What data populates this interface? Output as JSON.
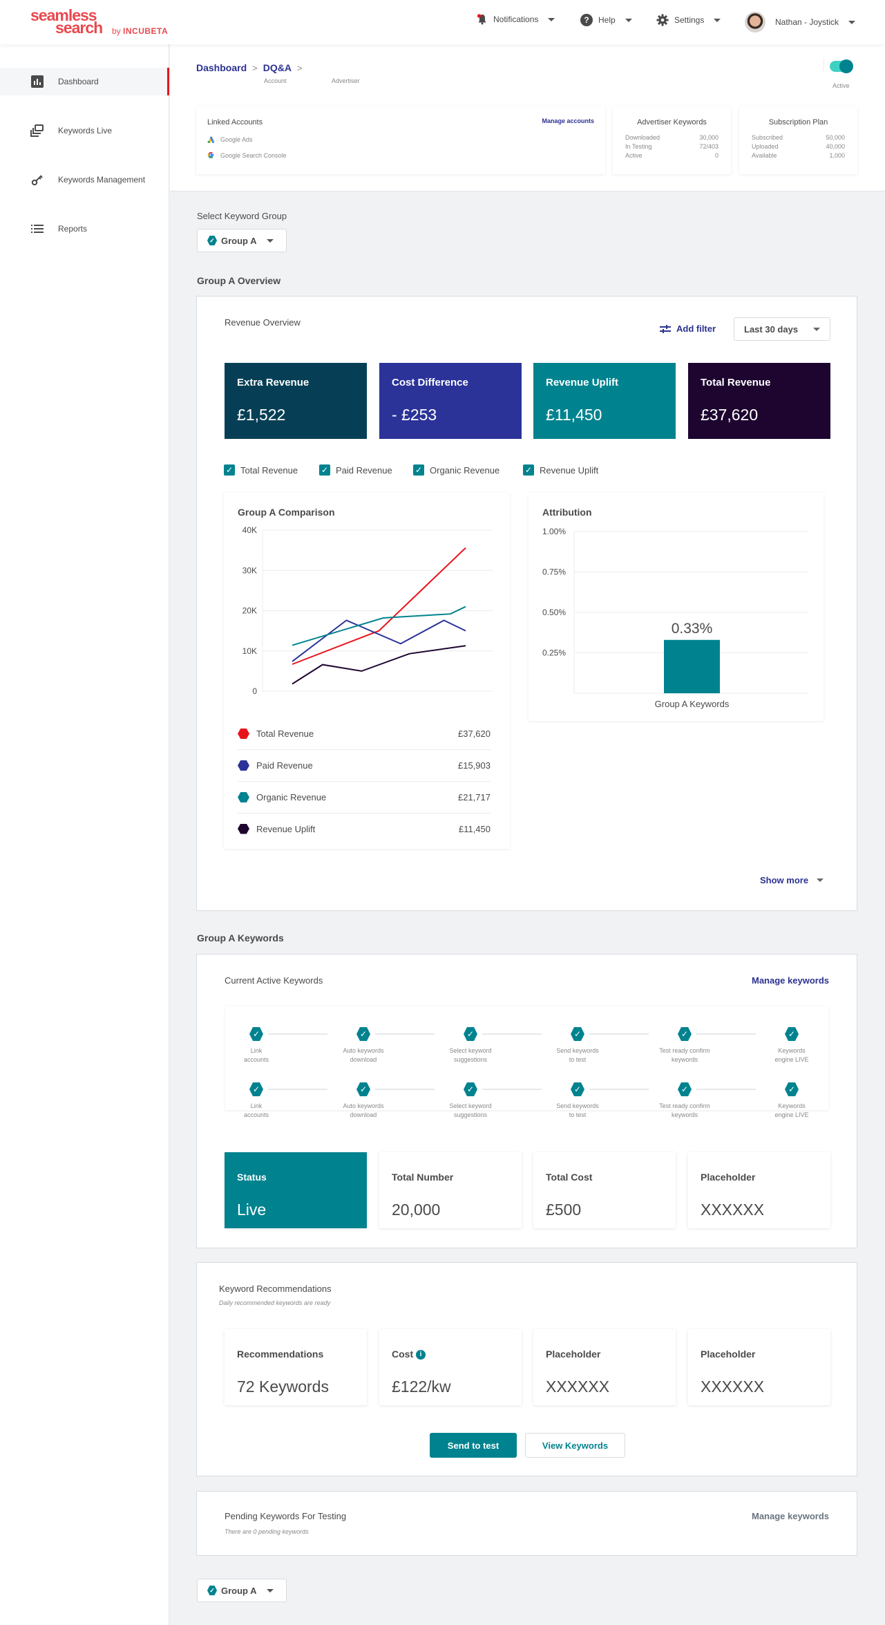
{
  "brand": {
    "line1": "seamless",
    "line2": "search",
    "by": "by",
    "company": "INCUBETA"
  },
  "topnav": {
    "notifications": "Notifications",
    "help": "Help",
    "settings": "Settings",
    "user": "Nathan - Joystick"
  },
  "sidebar": {
    "items": [
      {
        "label": "Dashboard",
        "icon": "bar-chart-icon",
        "active": true
      },
      {
        "label": "Keywords Live",
        "icon": "stack-icon",
        "active": false
      },
      {
        "label": "Keywords Management",
        "icon": "key-icon",
        "active": false
      },
      {
        "label": "Reports",
        "icon": "list-icon",
        "active": false
      }
    ]
  },
  "header": {
    "breadcrumb": [
      {
        "label": "Dashboard",
        "sub": "Account"
      },
      {
        "label": "DQ&A",
        "sub": "Advertiser"
      }
    ],
    "toggle_label": "Active",
    "toggle_on": true,
    "linked_accounts": {
      "title": "Linked Accounts",
      "manage": "Manage accounts",
      "accounts": [
        "Google Ads",
        "Google Search Console"
      ]
    },
    "advertiser_keywords": {
      "title": "Advertiser Keywords",
      "rows": [
        {
          "k": "Downloaded",
          "v": "30,000"
        },
        {
          "k": "In Testing",
          "v": "72/403"
        },
        {
          "k": "Active",
          "v": "0"
        }
      ]
    },
    "subscription": {
      "title": "Subscription Plan",
      "rows": [
        {
          "k": "Subscribed",
          "v": "50,000"
        },
        {
          "k": "Uploaded",
          "v": "40,000"
        },
        {
          "k": "Available",
          "v": "1,000"
        }
      ]
    }
  },
  "group_select": {
    "label": "Select Keyword Group",
    "value": "Group A"
  },
  "overview": {
    "title": "Group A Overview",
    "panel_label": "Revenue Overview",
    "add_filter": "Add filter",
    "range": "Last 30 days",
    "kpis": [
      {
        "title": "Extra Revenue",
        "value": "£1,522",
        "color": "#063f55"
      },
      {
        "title": "Cost Difference",
        "value": "- £253",
        "color": "#2b3399"
      },
      {
        "title": "Revenue Uplift",
        "value": "£11,450",
        "color": "#00838f"
      },
      {
        "title": "Total Revenue",
        "value": "£37,620",
        "color": "#1d0530"
      }
    ],
    "filters": [
      {
        "label": "Total Revenue",
        "checked": true
      },
      {
        "label": "Paid Revenue",
        "checked": true
      },
      {
        "label": "Organic Revenue",
        "checked": true
      },
      {
        "label": "Revenue Uplift",
        "checked": true
      }
    ],
    "legend": [
      {
        "label": "Total Revenue",
        "value": "£37,620",
        "color": "#e8141c"
      },
      {
        "label": "Paid Revenue",
        "value": "£15,903",
        "color": "#2b3399"
      },
      {
        "label": "Organic Revenue",
        "value": "£21,717",
        "color": "#00838f"
      },
      {
        "label": "Revenue Uplift",
        "value": "£11,450",
        "color": "#1d0530"
      }
    ],
    "show_more": "Show more"
  },
  "chart_data": [
    {
      "type": "line",
      "title": "Group A Comparison",
      "xlabel": "",
      "ylabel": "",
      "ylim": [
        0,
        40000
      ],
      "yticks": [
        0,
        10000,
        20000,
        30000,
        40000
      ],
      "ytick_labels": [
        "0",
        "10K",
        "20K",
        "30K",
        "40K"
      ],
      "xlim": [
        0,
        8
      ],
      "grid": true,
      "series": [
        {
          "name": "Total Revenue",
          "color": "#e8141c",
          "points": [
            [
              0,
              6700
            ],
            [
              4,
              15000
            ],
            [
              8,
              35600
            ]
          ]
        },
        {
          "name": "Paid Revenue",
          "color": "#2b3399",
          "points": [
            [
              0,
              7400
            ],
            [
              2.5,
              17600
            ],
            [
              5,
              11800
            ],
            [
              7,
              17600
            ],
            [
              8,
              15000
            ]
          ]
        },
        {
          "name": "Organic Revenue",
          "color": "#00838f",
          "points": [
            [
              0,
              11400
            ],
            [
              4.2,
              18200
            ],
            [
              7.3,
              19200
            ],
            [
              8,
              21000
            ]
          ]
        },
        {
          "name": "Revenue Uplift",
          "color": "#1d0530",
          "points": [
            [
              0,
              1800
            ],
            [
              1.4,
              6600
            ],
            [
              3.2,
              5000
            ],
            [
              5.4,
              9300
            ],
            [
              8,
              11300
            ]
          ]
        }
      ]
    },
    {
      "type": "bar",
      "title": "Attribution",
      "categories": [
        "Group A Keywords"
      ],
      "values": [
        0.33
      ],
      "value_labels": [
        "0.33%"
      ],
      "ylim": [
        0,
        1.0
      ],
      "yticks": [
        0.25,
        0.5,
        0.75,
        1.0
      ],
      "ytick_labels": [
        "0.25%",
        "0.50%",
        "0.75%",
        "1.00%"
      ],
      "color": "#00838f",
      "grid": true
    }
  ],
  "keywords": {
    "title": "Group A Keywords",
    "panel_label": "Current Active Keywords",
    "manage": "Manage keywords",
    "steps": [
      [
        "Link",
        "accounts"
      ],
      [
        "Auto keywords",
        "download"
      ],
      [
        "Select keyword",
        "suggestions"
      ],
      [
        "Send keywords",
        "to test"
      ],
      [
        "Test ready confirm",
        "keywords"
      ],
      [
        "Keywords",
        "engine LIVE"
      ]
    ],
    "stats": [
      {
        "title": "Status",
        "value": "Live"
      },
      {
        "title": "Total Number",
        "value": "20,000"
      },
      {
        "title": "Total Cost",
        "value": "£500"
      },
      {
        "title": "Placeholder",
        "value": "XXXXXX"
      }
    ]
  },
  "recommendations": {
    "title": "Keyword Recommendations",
    "subtitle": "Daily recommended keywords are ready",
    "stats": [
      {
        "title": "Recommendations",
        "value": "72 Keywords"
      },
      {
        "title": "Cost",
        "value": "£122/kw"
      },
      {
        "title": "Placeholder",
        "value": "XXXXXX"
      },
      {
        "title": "Placeholder",
        "value": "XXXXXX"
      }
    ],
    "send_button": "Send to test",
    "view_button": "View Keywords"
  },
  "pending": {
    "title": "Pending Keywords For Testing",
    "subtitle": "There are 0 pending keywords",
    "manage": "Manage keywords"
  },
  "bottom_select": {
    "value": "Group A"
  }
}
